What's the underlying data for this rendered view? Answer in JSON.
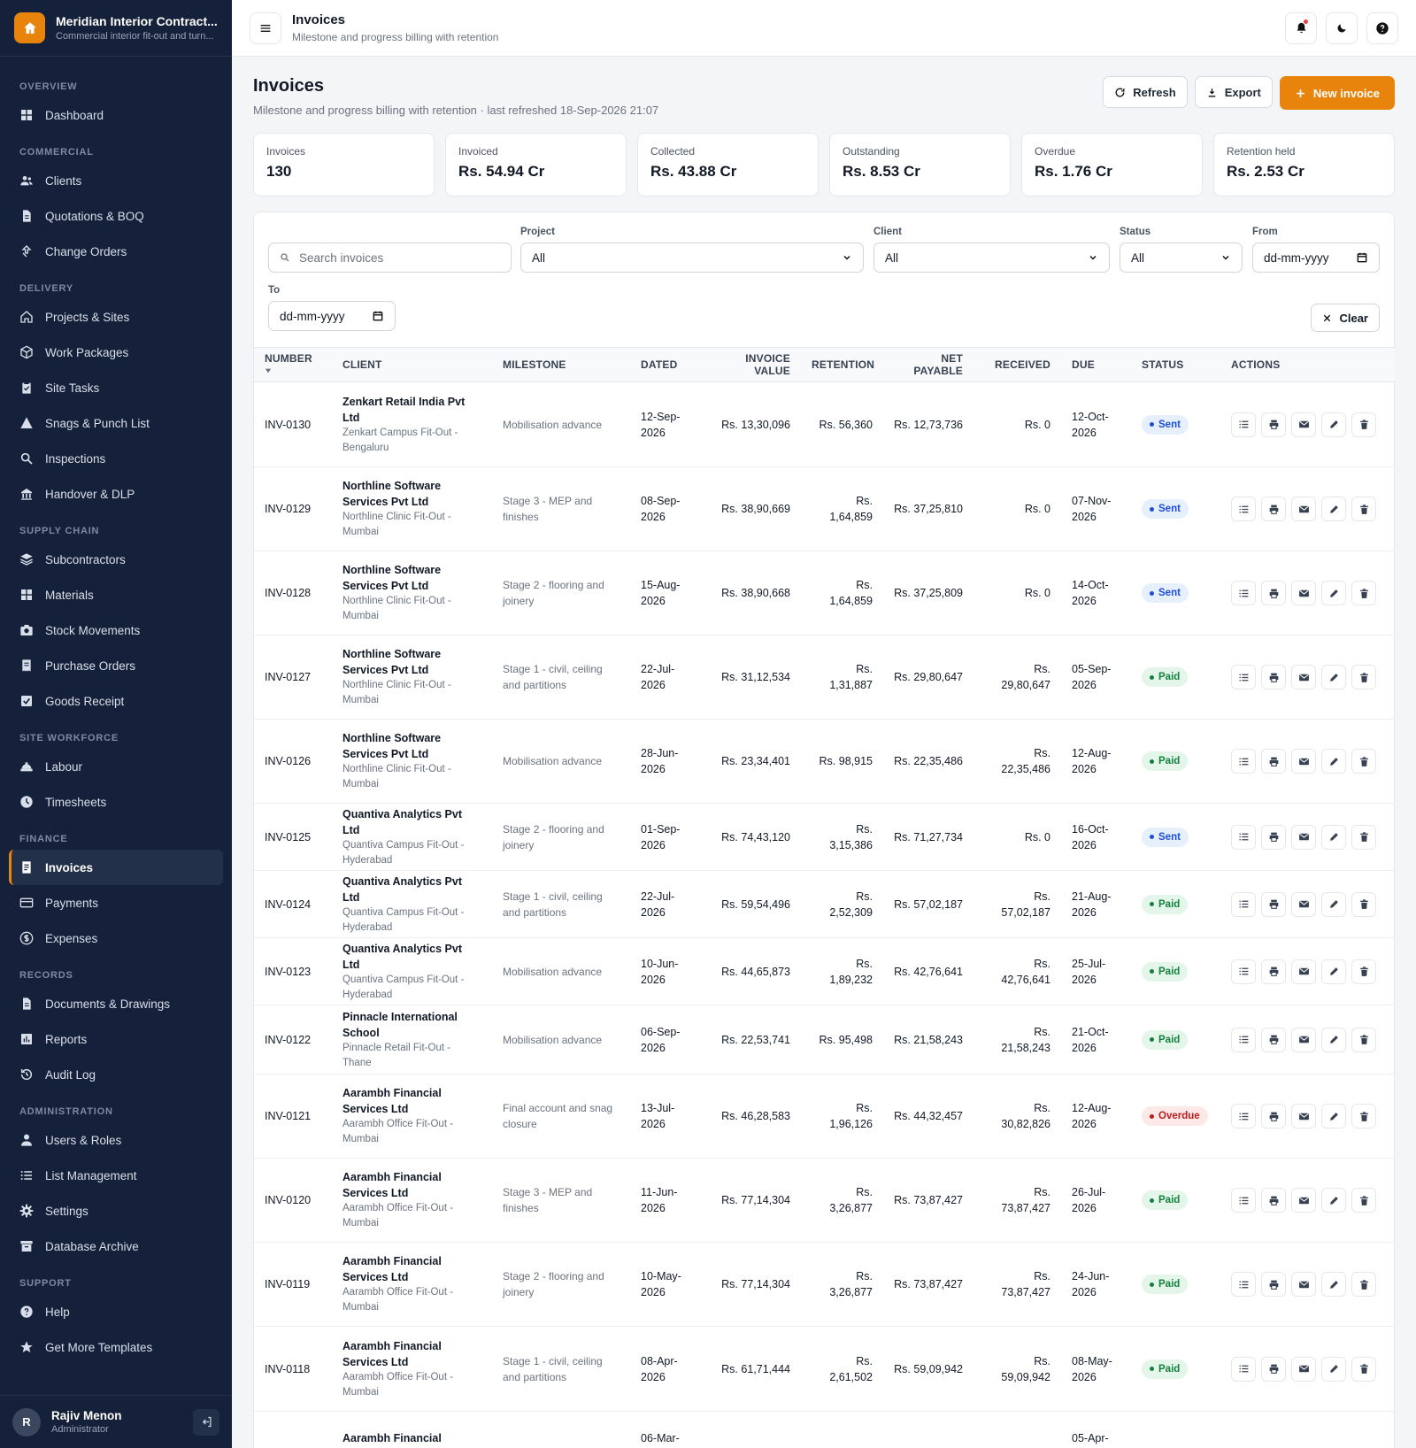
{
  "brand": {
    "name": "Meridian Interior Contract...",
    "subtitle": "Commercial interior fit-out and turn..."
  },
  "nav": [
    {
      "section": "OVERVIEW",
      "items": [
        {
          "label": "Dashboard",
          "icon": "grid-icon"
        }
      ]
    },
    {
      "section": "COMMERCIAL",
      "items": [
        {
          "label": "Clients",
          "icon": "users-icon"
        },
        {
          "label": "Quotations & BOQ",
          "icon": "document-icon"
        },
        {
          "label": "Change Orders",
          "icon": "swap-icon"
        }
      ]
    },
    {
      "section": "DELIVERY",
      "items": [
        {
          "label": "Projects & Sites",
          "icon": "home-icon"
        },
        {
          "label": "Work Packages",
          "icon": "package-icon"
        },
        {
          "label": "Site Tasks",
          "icon": "clipboard-icon"
        },
        {
          "label": "Snags & Punch List",
          "icon": "warning-icon"
        },
        {
          "label": "Inspections",
          "icon": "search-icon"
        },
        {
          "label": "Handover & DLP",
          "icon": "building-icon"
        }
      ]
    },
    {
      "section": "SUPPLY CHAIN",
      "items": [
        {
          "label": "Subcontractors",
          "icon": "layers-icon"
        },
        {
          "label": "Materials",
          "icon": "grid-icon"
        },
        {
          "label": "Stock Movements",
          "icon": "camera-icon"
        },
        {
          "label": "Purchase Orders",
          "icon": "receipt-icon"
        },
        {
          "label": "Goods Receipt",
          "icon": "checkbox-icon"
        }
      ]
    },
    {
      "section": "SITE WORKFORCE",
      "items": [
        {
          "label": "Labour",
          "icon": "hardhat-icon"
        },
        {
          "label": "Timesheets",
          "icon": "clock-icon"
        }
      ]
    },
    {
      "section": "FINANCE",
      "items": [
        {
          "label": "Invoices",
          "icon": "invoice-icon",
          "active": true
        },
        {
          "label": "Payments",
          "icon": "card-icon"
        },
        {
          "label": "Expenses",
          "icon": "coin-icon"
        }
      ]
    },
    {
      "section": "RECORDS",
      "items": [
        {
          "label": "Documents & Drawings",
          "icon": "document-icon"
        },
        {
          "label": "Reports",
          "icon": "chart-icon"
        },
        {
          "label": "Audit Log",
          "icon": "history-icon"
        }
      ]
    },
    {
      "section": "ADMINISTRATION",
      "items": [
        {
          "label": "Users & Roles",
          "icon": "user-icon"
        },
        {
          "label": "List Management",
          "icon": "list-icon"
        },
        {
          "label": "Settings",
          "icon": "gear-icon"
        },
        {
          "label": "Database Archive",
          "icon": "archive-icon"
        }
      ]
    },
    {
      "section": "SUPPORT",
      "items": [
        {
          "label": "Help",
          "icon": "help-icon"
        },
        {
          "label": "Get More Templates",
          "icon": "star-icon"
        }
      ]
    }
  ],
  "user": {
    "initial": "R",
    "name": "Rajiv Menon",
    "role": "Administrator"
  },
  "topbar": {
    "title": "Invoices",
    "subtitle": "Milestone and progress billing with retention"
  },
  "page": {
    "title": "Invoices",
    "subtitle": "Milestone and progress billing with retention · last refreshed 18-Sep-2026 21:07",
    "refresh": "Refresh",
    "export": "Export",
    "new_invoice": "New invoice"
  },
  "kpis": [
    {
      "label": "Invoices",
      "value": "130"
    },
    {
      "label": "Invoiced",
      "value": "Rs. 54.94 Cr"
    },
    {
      "label": "Collected",
      "value": "Rs. 43.88 Cr"
    },
    {
      "label": "Outstanding",
      "value": "Rs. 8.53 Cr"
    },
    {
      "label": "Overdue",
      "value": "Rs. 1.76 Cr"
    },
    {
      "label": "Retention held",
      "value": "Rs. 2.53 Cr"
    }
  ],
  "filters": {
    "search_placeholder": "Search invoices",
    "project_label": "Project",
    "project_value": "All",
    "client_label": "Client",
    "client_value": "All",
    "status_label": "Status",
    "status_value": "All",
    "from_label": "From",
    "from_value": "dd-mm-yyyy",
    "to_label": "To",
    "to_value": "dd-mm-yyyy",
    "clear": "Clear"
  },
  "table": {
    "columns": [
      "NUMBER",
      "CLIENT",
      "MILESTONE",
      "DATED",
      "INVOICE VALUE",
      "RETENTION",
      "NET PAYABLE",
      "RECEIVED",
      "DUE",
      "STATUS",
      "ACTIONS"
    ],
    "rows": [
      {
        "number": "INV-0130",
        "client": "Zenkart Retail India Pvt Ltd",
        "project": "Zenkart Campus Fit-Out - Bengaluru",
        "milestone": "Mobilisation advance",
        "dated": "12-Sep-2026",
        "value": "Rs. 13,30,096",
        "retention": "Rs. 56,360",
        "net": "Rs. 12,73,736",
        "received": "Rs. 0",
        "due": "12-Oct-2026",
        "status": "Sent",
        "h": 96
      },
      {
        "number": "INV-0129",
        "client": "Northline Software Services Pvt Ltd",
        "project": "Northline Clinic Fit-Out - Mumbai",
        "milestone": "Stage 3 - MEP and finishes",
        "dated": "08-Sep-2026",
        "value": "Rs. 38,90,669",
        "retention": "Rs. 1,64,859",
        "net": "Rs. 37,25,810",
        "received": "Rs. 0",
        "due": "07-Nov-2026",
        "status": "Sent",
        "h": 95
      },
      {
        "number": "INV-0128",
        "client": "Northline Software Services Pvt Ltd",
        "project": "Northline Clinic Fit-Out - Mumbai",
        "milestone": "Stage 2 - flooring and joinery",
        "dated": "15-Aug-2026",
        "value": "Rs. 38,90,668",
        "retention": "Rs. 1,64,859",
        "net": "Rs. 37,25,809",
        "received": "Rs. 0",
        "due": "14-Oct-2026",
        "status": "Sent",
        "h": 95
      },
      {
        "number": "INV-0127",
        "client": "Northline Software Services Pvt Ltd",
        "project": "Northline Clinic Fit-Out - Mumbai",
        "milestone": "Stage 1 - civil, ceiling and partitions",
        "dated": "22-Jul-2026",
        "value": "Rs. 31,12,534",
        "retention": "Rs. 1,31,887",
        "net": "Rs. 29,80,647",
        "received": "Rs. 29,80,647",
        "due": "05-Sep-2026",
        "status": "Paid",
        "h": 95
      },
      {
        "number": "INV-0126",
        "client": "Northline Software Services Pvt Ltd",
        "project": "Northline Clinic Fit-Out - Mumbai",
        "milestone": "Mobilisation advance",
        "dated": "28-Jun-2026",
        "value": "Rs. 23,34,401",
        "retention": "Rs. 98,915",
        "net": "Rs. 22,35,486",
        "received": "Rs. 22,35,486",
        "due": "12-Aug-2026",
        "status": "Paid",
        "h": 95
      },
      {
        "number": "INV-0125",
        "client": "Quantiva Analytics Pvt Ltd",
        "project": "Quantiva Campus Fit-Out - Hyderabad",
        "milestone": "Stage 2 - flooring and joinery",
        "dated": "01-Sep-2026",
        "value": "Rs. 74,43,120",
        "retention": "Rs. 3,15,386",
        "net": "Rs. 71,27,734",
        "received": "Rs. 0",
        "due": "16-Oct-2026",
        "status": "Sent",
        "h": 76
      },
      {
        "number": "INV-0124",
        "client": "Quantiva Analytics Pvt Ltd",
        "project": "Quantiva Campus Fit-Out - Hyderabad",
        "milestone": "Stage 1 - civil, ceiling and partitions",
        "dated": "22-Jul-2026",
        "value": "Rs. 59,54,496",
        "retention": "Rs. 2,52,309",
        "net": "Rs. 57,02,187",
        "received": "Rs. 57,02,187",
        "due": "21-Aug-2026",
        "status": "Paid",
        "h": 76
      },
      {
        "number": "INV-0123",
        "client": "Quantiva Analytics Pvt Ltd",
        "project": "Quantiva Campus Fit-Out - Hyderabad",
        "milestone": "Mobilisation advance",
        "dated": "10-Jun-2026",
        "value": "Rs. 44,65,873",
        "retention": "Rs. 1,89,232",
        "net": "Rs. 42,76,641",
        "received": "Rs. 42,76,641",
        "due": "25-Jul-2026",
        "status": "Paid",
        "h": 76
      },
      {
        "number": "INV-0122",
        "client": "Pinnacle International School",
        "project": "Pinnacle Retail Fit-Out - Thane",
        "milestone": "Mobilisation advance",
        "dated": "06-Sep-2026",
        "value": "Rs. 22,53,741",
        "retention": "Rs. 95,498",
        "net": "Rs. 21,58,243",
        "received": "Rs. 21,58,243",
        "due": "21-Oct-2026",
        "status": "Paid",
        "h": 78
      },
      {
        "number": "INV-0121",
        "client": "Aarambh Financial Services Ltd",
        "project": "Aarambh Office Fit-Out - Mumbai",
        "milestone": "Final account and snag closure",
        "dated": "13-Jul-2026",
        "value": "Rs. 46,28,583",
        "retention": "Rs. 1,96,126",
        "net": "Rs. 44,32,457",
        "received": "Rs. 30,82,826",
        "due": "12-Aug-2026",
        "status": "Overdue",
        "h": 95
      },
      {
        "number": "INV-0120",
        "client": "Aarambh Financial Services Ltd",
        "project": "Aarambh Office Fit-Out - Mumbai",
        "milestone": "Stage 3 - MEP and finishes",
        "dated": "11-Jun-2026",
        "value": "Rs. 77,14,304",
        "retention": "Rs. 3,26,877",
        "net": "Rs. 73,87,427",
        "received": "Rs. 73,87,427",
        "due": "26-Jul-2026",
        "status": "Paid",
        "h": 95
      },
      {
        "number": "INV-0119",
        "client": "Aarambh Financial Services Ltd",
        "project": "Aarambh Office Fit-Out - Mumbai",
        "milestone": "Stage 2 - flooring and joinery",
        "dated": "10-May-2026",
        "value": "Rs. 77,14,304",
        "retention": "Rs. 3,26,877",
        "net": "Rs. 73,87,427",
        "received": "Rs. 73,87,427",
        "due": "24-Jun-2026",
        "status": "Paid",
        "h": 95
      },
      {
        "number": "INV-0118",
        "client": "Aarambh Financial Services Ltd",
        "project": "Aarambh Office Fit-Out - Mumbai",
        "milestone": "Stage 1 - civil, ceiling and partitions",
        "dated": "08-Apr-2026",
        "value": "Rs. 61,71,444",
        "retention": "Rs. 2,61,502",
        "net": "Rs. 59,09,942",
        "received": "Rs. 59,09,942",
        "due": "08-May-2026",
        "status": "Paid",
        "h": 96
      },
      {
        "number": "",
        "client": "Aarambh Financial",
        "project": "",
        "milestone": "",
        "dated": "06-Mar-",
        "value": "",
        "retention": "",
        "net": "",
        "received": "",
        "due": "05-Apr-",
        "status": "",
        "h": 60
      }
    ]
  }
}
